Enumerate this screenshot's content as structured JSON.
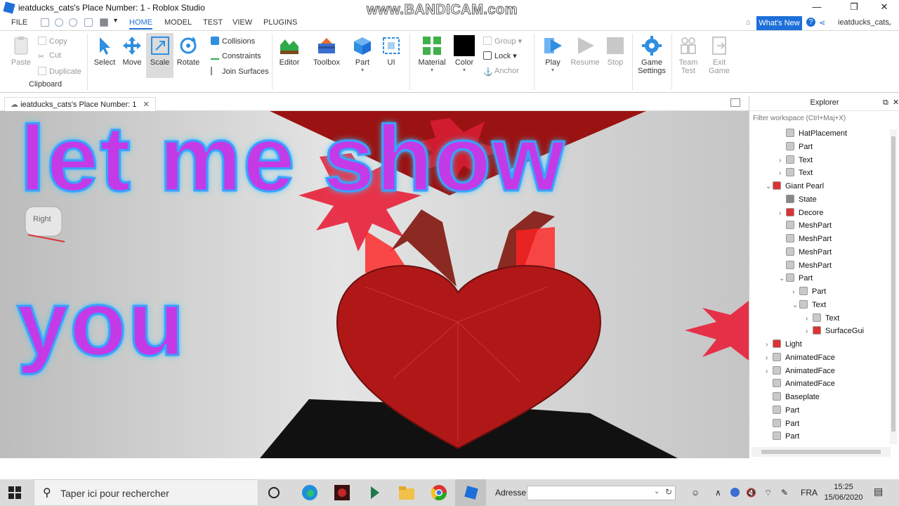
{
  "window": {
    "title": "ieatducks_cats's Place Number: 1 - Roblox Studio",
    "watermark": "www.BANDICAM.com",
    "minimize": "—",
    "maximize": "❐",
    "close": "✕"
  },
  "menu": {
    "file": "FILE",
    "tabs": [
      "HOME",
      "MODEL",
      "TEST",
      "VIEW",
      "PLUGINS"
    ],
    "active_tab": "HOME",
    "whats_new": "What's New",
    "username": "ieatducks_cats"
  },
  "ribbon": {
    "clipboard": {
      "paste": "Paste",
      "copy": "Copy",
      "cut": "Cut",
      "duplicate": "Duplicate",
      "group_label": "Clipboard"
    },
    "tools": {
      "select": "Select",
      "move": "Move",
      "scale": "Scale",
      "rotate": "Rotate",
      "collisions": "Collisions",
      "constraints": "Constraints",
      "join_surfaces": "Join Surfaces"
    },
    "insert": {
      "editor": "Editor",
      "toolbox": "Toolbox",
      "part": "Part",
      "ui": "UI"
    },
    "edit": {
      "material": "Material",
      "color": "Color",
      "group": "Group",
      "lock": "Lock",
      "anchor": "Anchor"
    },
    "test": {
      "play": "Play",
      "resume": "Resume",
      "stop": "Stop"
    },
    "settings": {
      "game_settings_line1": "Game",
      "game_settings_line2": "Settings",
      "team_test_line1": "Team",
      "team_test_line2": "Test",
      "exit_game_line1": "Exit",
      "exit_game_line2": "Game"
    }
  },
  "viewport": {
    "tab_label": "ieatducks_cats's Place Number: 1",
    "overlay_line1": "let me show",
    "overlay_line2": "you",
    "view_cube_label": "Right"
  },
  "explorer": {
    "title": "Explorer",
    "filter_placeholder": "Filter workspace (Ctrl+Maj+X)",
    "items": [
      {
        "label": "HatPlacement",
        "depth": 2,
        "expander": "",
        "icon": "part-icon"
      },
      {
        "label": "Part",
        "depth": 2,
        "expander": "",
        "icon": "part-icon"
      },
      {
        "label": "Text",
        "depth": 2,
        "expander": "›",
        "icon": "part-icon"
      },
      {
        "label": "Text",
        "depth": 2,
        "expander": "›",
        "icon": "part-icon"
      },
      {
        "label": "Giant Pearl",
        "depth": 1,
        "expander": "⌄",
        "icon": "model-icon"
      },
      {
        "label": "State",
        "depth": 2,
        "expander": "",
        "icon": "value-icon"
      },
      {
        "label": "Decore",
        "depth": 2,
        "expander": "›",
        "icon": "model-icon"
      },
      {
        "label": "MeshPart",
        "depth": 2,
        "expander": "",
        "icon": "part-icon"
      },
      {
        "label": "MeshPart",
        "depth": 2,
        "expander": "",
        "icon": "part-icon"
      },
      {
        "label": "MeshPart",
        "depth": 2,
        "expander": "",
        "icon": "part-icon"
      },
      {
        "label": "MeshPart",
        "depth": 2,
        "expander": "",
        "icon": "part-icon"
      },
      {
        "label": "Part",
        "depth": 2,
        "expander": "⌄",
        "icon": "part-icon"
      },
      {
        "label": "Part",
        "depth": 3,
        "expander": "›",
        "icon": "part-icon"
      },
      {
        "label": "Text",
        "depth": 3,
        "expander": "⌄",
        "icon": "part-icon"
      },
      {
        "label": "Text",
        "depth": 4,
        "expander": "›",
        "icon": "part-icon"
      },
      {
        "label": "SurfaceGui",
        "depth": 4,
        "expander": "›",
        "icon": "gui-icon"
      },
      {
        "label": "Light",
        "depth": 1,
        "expander": "›",
        "icon": "model-icon"
      },
      {
        "label": "AnimatedFace",
        "depth": 1,
        "expander": "›",
        "icon": "part-icon"
      },
      {
        "label": "AnimatedFace",
        "depth": 1,
        "expander": "›",
        "icon": "part-icon"
      },
      {
        "label": "AnimatedFace",
        "depth": 1,
        "expander": "",
        "icon": "part-icon"
      },
      {
        "label": "Baseplate",
        "depth": 1,
        "expander": "",
        "icon": "part-icon"
      },
      {
        "label": "Part",
        "depth": 1,
        "expander": "",
        "icon": "part-icon"
      },
      {
        "label": "Part",
        "depth": 1,
        "expander": "",
        "icon": "part-icon"
      },
      {
        "label": "Part",
        "depth": 1,
        "expander": "",
        "icon": "part-icon"
      }
    ]
  },
  "taskbar": {
    "search_placeholder": "Taper ici pour rechercher",
    "address_label": "Adresse",
    "language": "FRA",
    "time": "15:25",
    "date": "15/06/2020"
  },
  "colors": {
    "accent": "#1e6fd9",
    "overlay_text": "#c43ae6",
    "overlay_glow": "#3aa0ff",
    "heart": "#b01818"
  }
}
